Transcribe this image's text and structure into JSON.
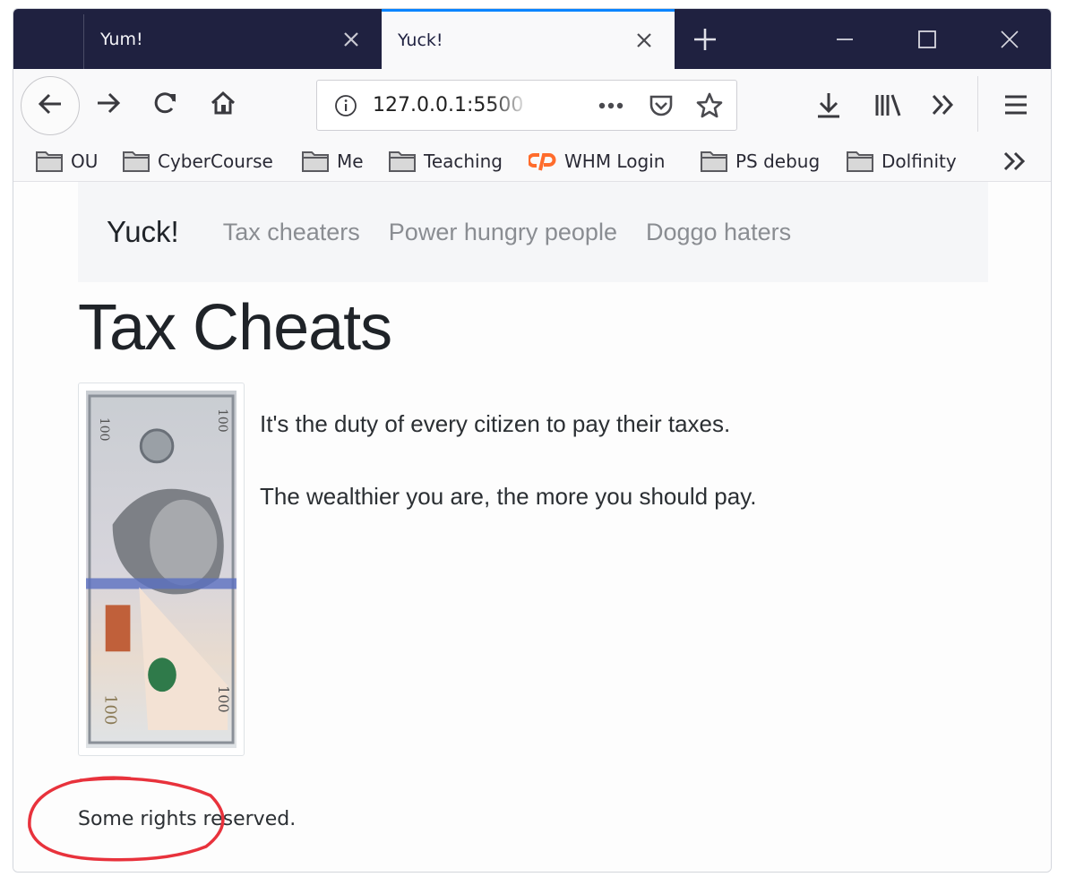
{
  "browser": {
    "tabs": [
      {
        "title": "Yum!",
        "active": false
      },
      {
        "title": "Yuck!",
        "active": true
      }
    ],
    "new_tab_icon": "plus-icon",
    "window_controls": [
      "minimize-icon",
      "maximize-icon",
      "close-icon"
    ],
    "toolbar": {
      "back_icon": "arrow-left-icon",
      "forward_icon": "arrow-right-icon",
      "reload_icon": "reload-icon",
      "home_icon": "home-icon",
      "url": "127.0.0.1:5500",
      "url_icons": [
        "info-icon",
        "more-dots-icon",
        "pocket-icon",
        "star-icon"
      ],
      "right_icons": [
        "download-icon",
        "library-icon",
        "overflow-chevrons-icon",
        "hamburger-menu-icon"
      ]
    },
    "bookmarks": [
      {
        "label": "OU",
        "icon": "folder-icon"
      },
      {
        "label": "CyberCourse",
        "icon": "folder-icon"
      },
      {
        "label": "Me",
        "icon": "folder-icon"
      },
      {
        "label": "Teaching",
        "icon": "folder-icon"
      },
      {
        "label": "WHM Login",
        "icon": "cpanel-icon"
      },
      {
        "label": "PS debug",
        "icon": "folder-icon"
      },
      {
        "label": "Dolfinity",
        "icon": "folder-icon"
      }
    ]
  },
  "page": {
    "navbar": {
      "brand": "Yuck!",
      "links": [
        "Tax cheaters",
        "Power hungry people",
        "Doggo haters"
      ]
    },
    "title": "Tax Cheats",
    "image_alt": "100 dollar bill",
    "paragraphs": [
      "It's the duty of every citizen to pay their taxes.",
      "The wealthier you are, the more you should pay."
    ],
    "footer": "Some rights reserved.",
    "annotation": {
      "shape": "ellipse",
      "color": "#e8323c"
    }
  },
  "colors": {
    "tabstrip": "#1f2140",
    "active_tab_accent": "#0a84ff",
    "cpanel_orange": "#ff6c2c"
  }
}
